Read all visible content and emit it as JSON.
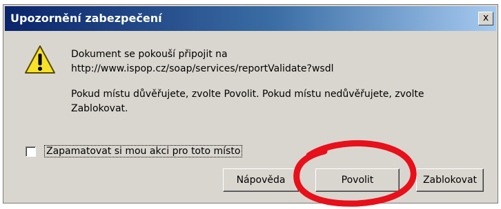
{
  "dialog": {
    "title": "Upozornění zabezpečení",
    "close_label": "x",
    "icon": "warning-icon",
    "message_line1": "Dokument se pokouší připojit na",
    "message_url": "http://www.ispop.cz/soap/services/reportValidate?wsdl",
    "message_line3": "Pokud místu důvěřujete, zvolte Povolit. Pokud místu nedůvěřujete, zvolte Zablokovat.",
    "remember_label": "Zapamatovat si mou akci pro toto místo",
    "remember_checked": false,
    "buttons": {
      "help": "Nápověda",
      "allow": "Povolit",
      "block": "Zablokovat"
    }
  },
  "colors": {
    "title_bar_start": "#0a246a",
    "title_bar_end": "#a6caf0",
    "dialog_bg": "#d9d6cf",
    "highlight_circle": "#e8101a"
  }
}
